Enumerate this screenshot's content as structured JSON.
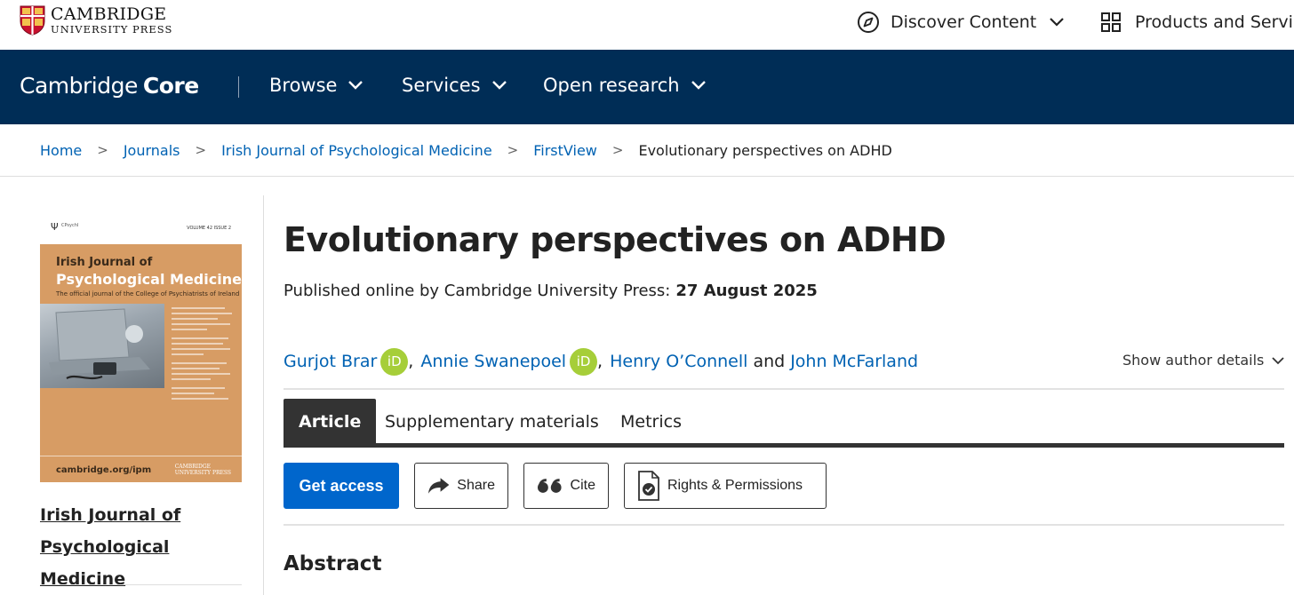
{
  "header": {
    "logo": {
      "line1": "CAMBRIDGE",
      "line2": "UNIVERSITY PRESS",
      "icon": "cambridge-shield-icon"
    },
    "discover": {
      "label": "Discover Content",
      "icon": "compass-icon"
    },
    "products": {
      "label": "Products and Servic",
      "icon": "grid-icon"
    }
  },
  "core_nav": {
    "logo_regular": "Cambridge",
    "logo_bold": "Core",
    "items": [
      {
        "label": "Browse"
      },
      {
        "label": "Services"
      },
      {
        "label": "Open research"
      }
    ]
  },
  "breadcrumb": {
    "separator": ">",
    "items": [
      "Home",
      "Journals",
      "Irish Journal of Psychological Medicine",
      "FirstView"
    ],
    "current": "Evolutionary perspectives on ADHD"
  },
  "cover": {
    "psi": "Ψ",
    "psi_org": "CPsychI",
    "volume": "VOLUME 42  ISSUE 2",
    "journal_line1": "Irish Journal of",
    "journal_line2": "Psychological Medicine",
    "tagline": "The official journal of the College of Psychiatrists of Ireland",
    "url": "cambridge.org/ipm",
    "publisher_line1": "CAMBRIDGE",
    "publisher_line2": "UNIVERSITY PRESS"
  },
  "journal": {
    "name_line1": "Irish Journal of",
    "name_line2": "Psychological Medicine"
  },
  "article": {
    "title": "Evolutionary perspectives on ADHD",
    "published_prefix": "Published online by Cambridge University Press:",
    "published_date": "27 August 2025",
    "authors": [
      {
        "name": "Gurjot Brar",
        "orcid": "iD"
      },
      {
        "name": "Annie Swanepoel",
        "orcid": "iD"
      },
      {
        "name": "Henry O’Connell"
      },
      {
        "name": "John McFarland"
      }
    ],
    "author_sep": ",",
    "author_and": "and",
    "show_details": "Show author details"
  },
  "tabs": [
    "Article",
    "Supplementary materials",
    "Metrics"
  ],
  "actions": {
    "get_access": "Get access",
    "share": "Share",
    "cite": "Cite",
    "rights": "Rights & Permissions"
  },
  "sections": {
    "abstract": "Abstract"
  },
  "colors": {
    "navy": "#002d56",
    "link": "#0062b3",
    "primary_button": "#0066cc",
    "orcid_green": "#a6ce39",
    "cover_orange": "#d79c64"
  }
}
